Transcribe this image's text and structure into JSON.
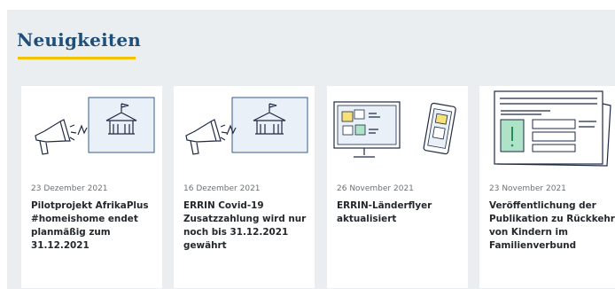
{
  "section": {
    "title": "Neuigkeiten"
  },
  "news": [
    {
      "date": "23 Dezember 2021",
      "title": "Pilotprojekt AfrikaPlus #homeishome endet planmäßig zum 31.12.2021",
      "icon": "megaphone-building-icon"
    },
    {
      "date": "16 Dezember 2021",
      "title": "ERRIN Covid-19 Zusatzzahlung wird nur noch bis 31.12.2021 gewährt",
      "icon": "megaphone-building-icon"
    },
    {
      "date": "26 November 2021",
      "title": "ERRIN-Länderflyer aktualisiert",
      "icon": "monitor-tablet-icon"
    },
    {
      "date": "23 November 2021",
      "title": "Veröffentlichung der Publikation zu Rückkehr von Kindern im Familienverbund",
      "icon": "newspaper-icon"
    }
  ],
  "colors": {
    "accent": "#f3c200",
    "title": "#1f4e79",
    "panel": "#ebeef1"
  }
}
